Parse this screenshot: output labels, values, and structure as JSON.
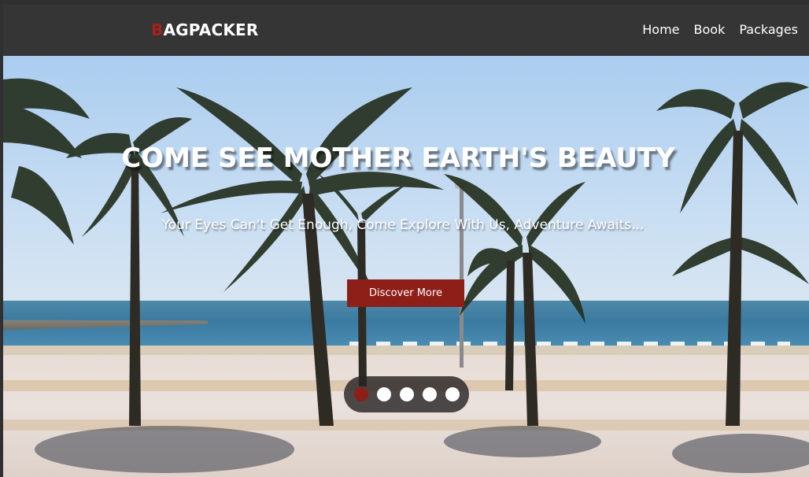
{
  "nav": {
    "logo_first": "B",
    "logo_rest": "AGPACKER",
    "links": [
      "Home",
      "Book",
      "Packages"
    ]
  },
  "hero": {
    "title": "COME SEE MOTHER EARTH'S BEAUTY",
    "subtitle": "Your Eyes Can't Get Enough, Come Explore With Us, Adventure Awaits...",
    "cta_label": "Discover More"
  },
  "slider": {
    "slide_count": 5,
    "active_index": 0
  },
  "colors": {
    "accent": "#8e1e18",
    "navbar": "#353535",
    "text": "#ffffff"
  }
}
